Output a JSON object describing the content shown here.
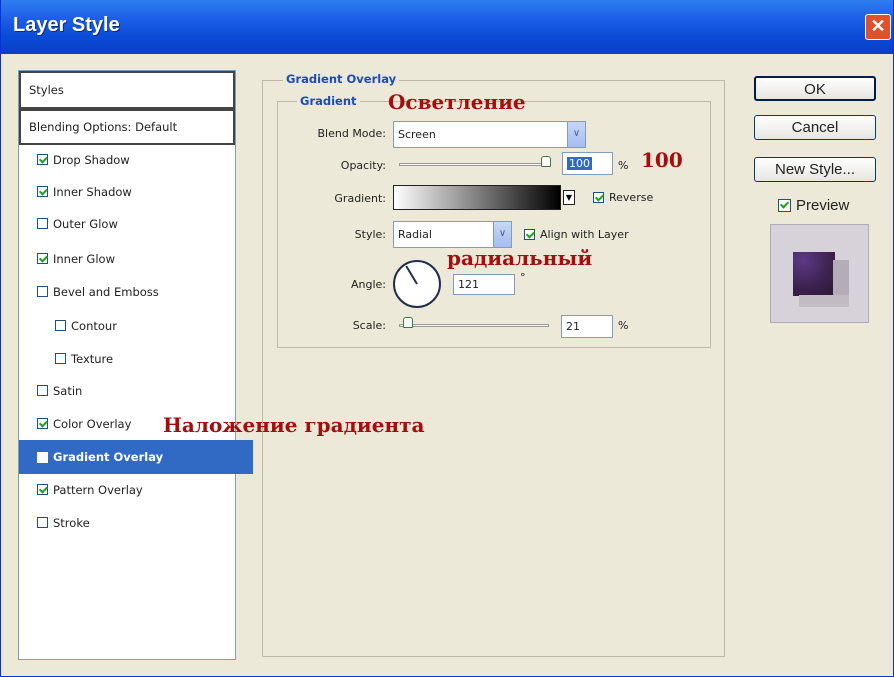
{
  "window": {
    "title": "Layer Style",
    "close_glyph": "✕"
  },
  "styles_list": {
    "header": "Styles",
    "blending_options": "Blending Options: Default",
    "items": [
      {
        "label": "Drop Shadow",
        "checked": true
      },
      {
        "label": "Inner Shadow",
        "checked": true
      },
      {
        "label": "Outer Glow",
        "checked": false
      },
      {
        "label": "Inner Glow",
        "checked": true
      },
      {
        "label": "Bevel and Emboss",
        "checked": false
      },
      {
        "label": "Contour",
        "checked": false
      },
      {
        "label": "Texture",
        "checked": false
      },
      {
        "label": "Satin",
        "checked": false
      },
      {
        "label": "Color Overlay",
        "checked": true
      },
      {
        "label": "Gradient Overlay",
        "checked": true,
        "selected": true
      },
      {
        "label": "Pattern Overlay",
        "checked": true
      },
      {
        "label": "Stroke",
        "checked": false
      }
    ]
  },
  "gradient_overlay": {
    "group_title": "Gradient Overlay",
    "subgroup_title": "Gradient",
    "blend_mode_label": "Blend Mode:",
    "blend_mode_value": "Screen",
    "opacity_label": "Opacity:",
    "opacity_value": "100",
    "opacity_unit": "%",
    "gradient_label": "Gradient:",
    "reverse_label": "Reverse",
    "reverse_checked": true,
    "style_label": "Style:",
    "style_value": "Radial",
    "align_label": "Align with Layer",
    "align_checked": true,
    "angle_label": "Angle:",
    "angle_value": "121",
    "angle_unit": "°",
    "scale_label": "Scale:",
    "scale_value": "21",
    "scale_unit": "%"
  },
  "buttons": {
    "ok": "OK",
    "cancel": "Cancel",
    "new_style": "New Style..."
  },
  "preview": {
    "label": "Preview",
    "checked": true
  },
  "annotations": {
    "blend_note": "Осветление",
    "opacity_note": "100",
    "style_note": "радиальный",
    "overlay_note": "Наложение градиента"
  },
  "colors": {
    "accent": "#316ac5",
    "annotation": "#a80d0d",
    "title_bar": "#0a4bd6"
  }
}
